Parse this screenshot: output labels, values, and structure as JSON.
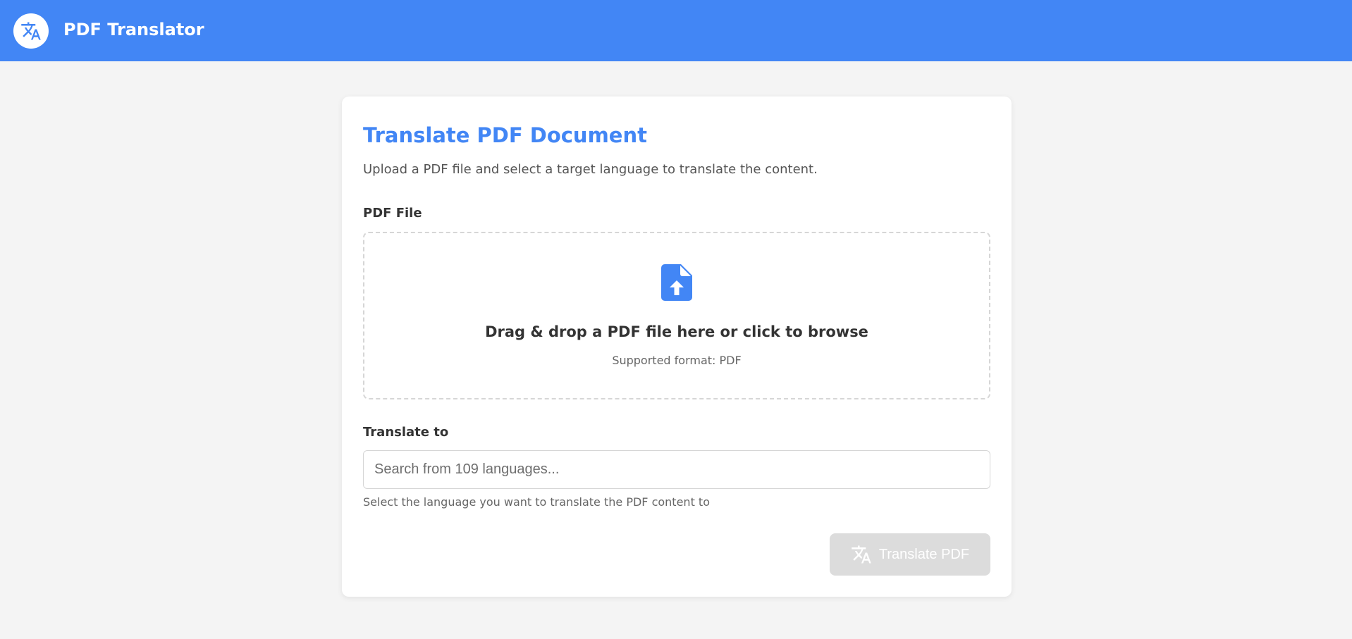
{
  "header": {
    "app_title": "PDF Translator",
    "logo_icon": "translate-icon",
    "background_color": "#4286f5"
  },
  "card": {
    "title": "Translate PDF Document",
    "subtitle": "Upload a PDF file and select a target language to translate the content.",
    "file_label": "PDF File",
    "dropzone": {
      "icon": "file-upload-icon",
      "title": "Drag & drop a PDF file here or click to browse",
      "subtitle": "Supported format: PDF"
    },
    "language_label": "Translate to",
    "language_input": {
      "value": "",
      "placeholder": "Search from 109 languages..."
    },
    "language_help": "Select the language you want to translate the PDF content to",
    "translate_button": {
      "label": "Translate PDF",
      "icon": "translate-icon",
      "state": "disabled"
    }
  },
  "colors": {
    "accent": "#4286f5",
    "background": "#f4f4f4",
    "card": "#ffffff",
    "disabled_button": "#dcdcdc"
  }
}
